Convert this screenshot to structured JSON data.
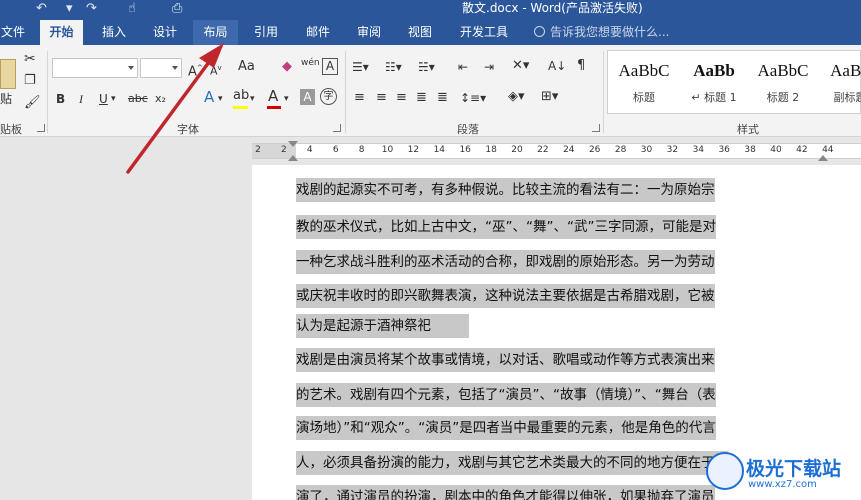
{
  "window": {
    "title": "散文.docx - Word(产品激活失败)"
  },
  "tabs": [
    {
      "label": "文件"
    },
    {
      "label": "开始"
    },
    {
      "label": "插入"
    },
    {
      "label": "设计"
    },
    {
      "label": "布局"
    },
    {
      "label": "引用"
    },
    {
      "label": "邮件"
    },
    {
      "label": "审阅"
    },
    {
      "label": "视图"
    },
    {
      "label": "开发工具"
    }
  ],
  "tell_me": {
    "placeholder": "告诉我您想要做什么..."
  },
  "ribbon": {
    "clipboard": {
      "paste_label": "贴",
      "group_label": "贴板"
    },
    "font": {
      "group_label": "字体",
      "font_name": "",
      "font_size": "",
      "change_case": "Aa",
      "phonetic": "wén",
      "bold": "B",
      "italic": "I",
      "underline": "U",
      "strike": "abc",
      "subscript": "x₂",
      "text_effects": "A",
      "font_color": "A",
      "char_shading": "A",
      "enclose": "字"
    },
    "paragraph": {
      "group_label": "段落"
    },
    "styles": {
      "group_label": "样式",
      "items": [
        {
          "sample": "AaBbC",
          "name": "标题"
        },
        {
          "sample": "AaBb",
          "name": "↵ 标题 1"
        },
        {
          "sample": "AaBbC",
          "name": "标题 2"
        },
        {
          "sample": "AaBb",
          "name": "副标题"
        }
      ]
    }
  },
  "ruler": {
    "numbers": [
      "2",
      "2",
      "4",
      "6",
      "8",
      "10",
      "12",
      "14",
      "16",
      "18",
      "20",
      "22",
      "24",
      "26",
      "28",
      "30",
      "32",
      "34",
      "36",
      "38",
      "40",
      "42",
      "44"
    ]
  },
  "document": {
    "lines": [
      "戏剧的起源实不可考，有多种假说。比较主流的看法有二：一为原始宗",
      "教的巫术仪式，比如上古中文，“巫”、“舞”、“武”三字同源，可能是对",
      "一种乞求战斗胜利的巫术活动的合称，即戏剧的原始形态。另一为劳动",
      "或庆祝丰收时的即兴歌舞表演，这种说法主要依据是古希腊戏剧，它被",
      "认为是起源于酒神祭祀",
      "戏剧是由演员将某个故事或情境，以对话、歌唱或动作等方式表演出来",
      "的艺术。戏剧有四个元素，包括了“演员”、“故事（情境）”、“舞台（表",
      "演场地）”和“观众”。“演员”是四者当中最重要的元素，他是角色的代言",
      "人，必须具备扮演的能力，戏剧与其它艺术类最大的不同的地方便在于扮",
      "演了，通过演员的扮演，剧本中的角色才能得以伸张，如果抛弃了演员"
    ]
  },
  "watermark": {
    "text": "极光下载站",
    "url": "www.xz7.com"
  },
  "colors": {
    "title_bar": "#2b579a",
    "ribbon": "#f3f3f3",
    "selection": "#c8c8c8",
    "arrow": "#c0262d",
    "watermark": "#1d6fd6"
  }
}
